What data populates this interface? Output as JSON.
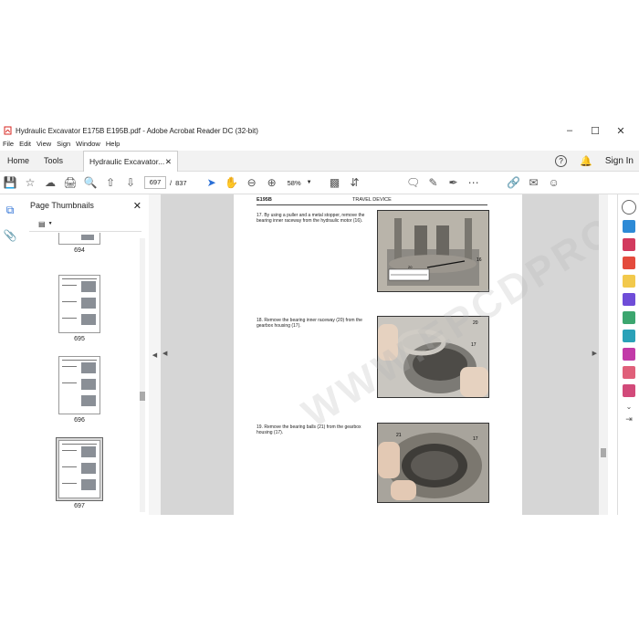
{
  "window": {
    "title": "Hydraulic Excavator E175B E195B.pdf - Adobe Acrobat Reader DC (32-bit)",
    "controls": [
      "minimize",
      "maximize",
      "close"
    ]
  },
  "menu": [
    "File",
    "Edit",
    "View",
    "Sign",
    "Window",
    "Help"
  ],
  "tabs": {
    "home": "Home",
    "tools": "Tools",
    "document": "Hydraulic Excavator...",
    "sign_in": "Sign In"
  },
  "toolbar": {
    "current_page": "697",
    "separator": "/",
    "total_pages": "837",
    "zoom": "58%"
  },
  "thumbnails": {
    "title": "Page Thumbnails",
    "pages": [
      "694",
      "695",
      "696",
      "697"
    ],
    "selected": "697"
  },
  "document": {
    "header_left": "E195B",
    "header_center": "TRAVEL DEVICE",
    "steps": [
      {
        "text": "17.  By using a puller and a metal stopper, remove the bearing inner raceway from the hydraulic motor (16).",
        "photo_labels": [
          "16",
          "20"
        ]
      },
      {
        "text": "18.  Remove the bearing inner raceway (20) from the gearbox housing (17).",
        "photo_labels": [
          "20",
          "17"
        ]
      },
      {
        "text": "19.  Remove the bearing balls (21) from the gearbox housing (17).",
        "photo_labels": [
          "21",
          "17"
        ]
      }
    ],
    "watermark": "WWW.EPCDPRO.COM"
  },
  "colors": {
    "acrobat_red": "#d7261f",
    "doc_background": "#d6d6d6",
    "selected_thumb": "#d8d8d8"
  }
}
